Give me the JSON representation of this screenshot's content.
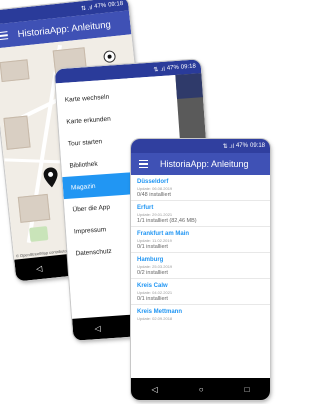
{
  "status": {
    "icons": "⇅ .ıl",
    "battery": "47%",
    "time": "09:18"
  },
  "phone1": {
    "app_title": "HistoriaApp: Anleitung",
    "map_attribution": "© OpenStreetMap contributors"
  },
  "phone2": {
    "menu_items": [
      "Karte wechseln",
      "Karte erkunden",
      "Tour starten",
      "Bibliothek",
      "Magazin",
      "Über die App",
      "Impressum",
      "Datenschutz"
    ],
    "active_item": "Magazin"
  },
  "phone3": {
    "app_title": "HistoriaApp: Anleitung",
    "cities": [
      {
        "name": "Düsseldorf",
        "update": "Update: 06.08.2019",
        "installed": "0/48 installiert"
      },
      {
        "name": "Erfurt",
        "update": "Update: 29.01.2021",
        "installed": "1/1 installiert (82,46 MB)"
      },
      {
        "name": "Frankfurt am Main",
        "update": "Update: 11.02.2019",
        "installed": "0/1 installiert"
      },
      {
        "name": "Hamburg",
        "update": "Update: 25.03.2019",
        "installed": "0/2 installiert"
      },
      {
        "name": "Kreis Calw",
        "update": "Update: 04.02.2021",
        "installed": "0/1 installiert"
      },
      {
        "name": "Kreis Mettmann",
        "update": "Update: 02.09.2018",
        "installed": ""
      }
    ]
  },
  "colors": {
    "primary": "#3f51b5",
    "accent": "#2196f3",
    "statusbar": "#303f9f"
  }
}
